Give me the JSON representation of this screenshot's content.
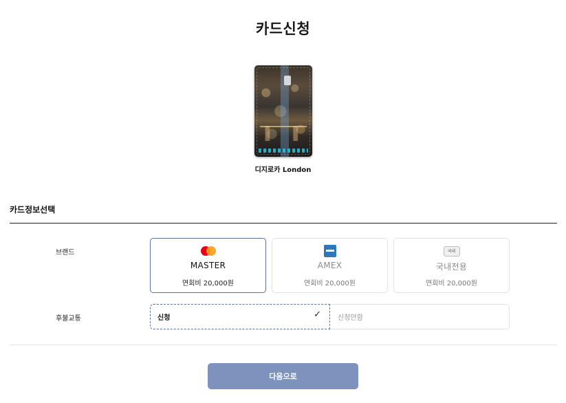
{
  "page": {
    "title": "카드신청"
  },
  "card": {
    "name": "디지로카 London",
    "image_label": "card-image-london"
  },
  "section": {
    "title": "카드정보선택"
  },
  "brand": {
    "label": "브랜드",
    "options": [
      {
        "name": "MASTER",
        "fee": "연회비 20,000원",
        "icon": "mastercard-icon",
        "selected": true
      },
      {
        "name": "AMEX",
        "fee": "연회비 20,000원",
        "icon": "amex-icon",
        "selected": false
      },
      {
        "name": "국내전용",
        "fee": "연회비 20,000원",
        "icon": "domestic-card-icon",
        "icon_text": "국내",
        "selected": false
      }
    ]
  },
  "transport": {
    "label": "후불교통",
    "yes_label": "신청",
    "no_label": "신청안함",
    "selected": "yes"
  },
  "actions": {
    "next_label": "다음으로"
  },
  "colors": {
    "accent": "#5a7396",
    "button": "#7d93bd",
    "amex": "#2e77bb",
    "mastercard_red": "#eb001b",
    "mastercard_orange": "#f79e1b"
  }
}
